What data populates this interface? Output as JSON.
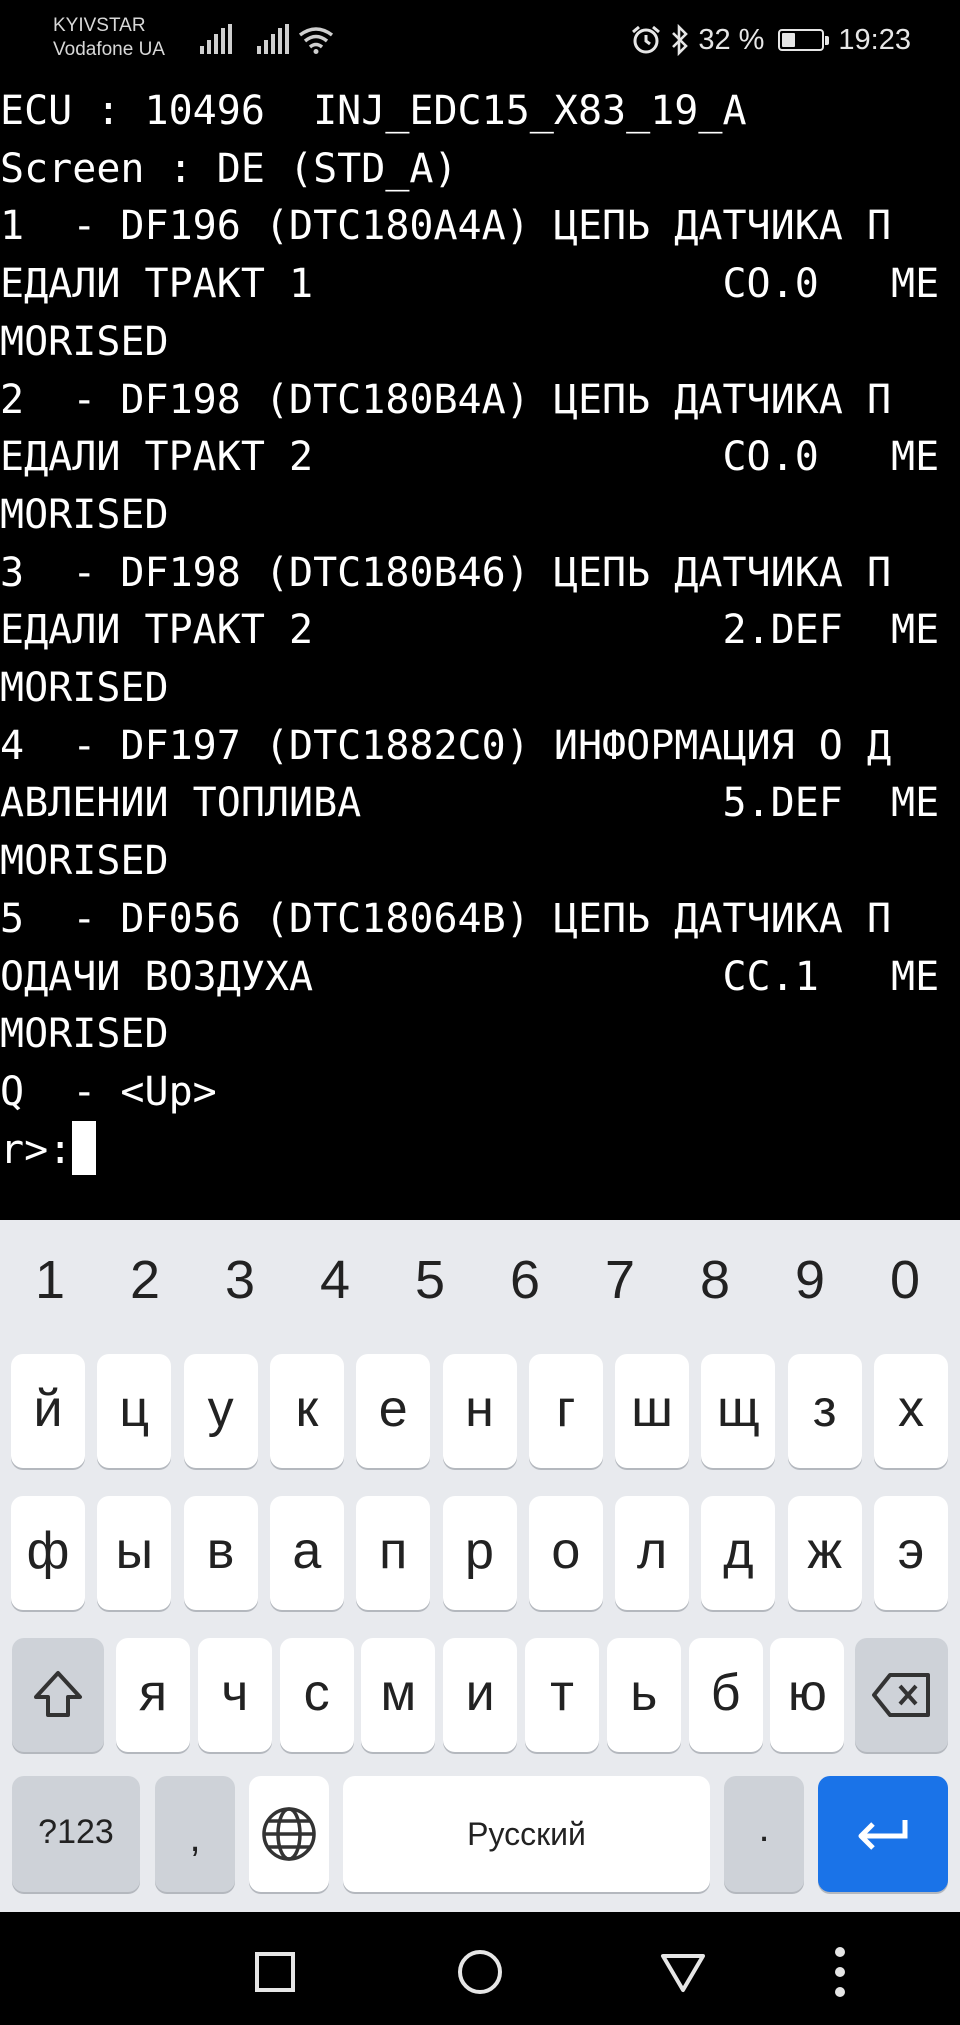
{
  "status_bar": {
    "carrier_1": "KYIVSTAR",
    "carrier_2": "Vodafone UA",
    "battery_percent": "32 %",
    "battery_level": 0.32,
    "time": "19:23",
    "icons": [
      "signal-icon",
      "signal-icon",
      "wifi-icon",
      "alarm-icon",
      "bluetooth-icon",
      "battery-icon"
    ]
  },
  "terminal": {
    "lines": [
      "ECU : 10496  INJ_EDC15_X83_19_A",
      "Screen : DE (STD_A)",
      "1  - DF196 (DTC180A4A) ЦЕПЬ ДАТЧИКА П",
      "ЕДАЛИ ТРАКТ 1                 CO.0   ME",
      "MORISED",
      "2  - DF198 (DTC180B4A) ЦЕПЬ ДАТЧИКА П",
      "ЕДАЛИ ТРАКТ 2                 CO.0   ME",
      "MORISED",
      "3  - DF198 (DTC180B46) ЦЕПЬ ДАТЧИКА П",
      "ЕДАЛИ ТРАКТ 2                 2.DEF  ME",
      "MORISED",
      "4  - DF197 (DTC1882C0) ИНФОРМАЦИЯ О Д",
      "АВЛЕНИИ ТОПЛИВА               5.DEF  ME",
      "MORISED",
      "5  - DF056 (DTC18064B) ЦЕПЬ ДАТЧИКА П",
      "ОДАЧИ ВОЗДУХА                 CC.1   ME",
      "MORISED",
      "Q  - <Up>",
      "r>:"
    ]
  },
  "keyboard": {
    "numbers": [
      "1",
      "2",
      "3",
      "4",
      "5",
      "6",
      "7",
      "8",
      "9",
      "0"
    ],
    "row_a": [
      "й",
      "ц",
      "у",
      "к",
      "е",
      "н",
      "г",
      "ш",
      "щ",
      "з",
      "х"
    ],
    "row_b": [
      "ф",
      "ы",
      "в",
      "а",
      "п",
      "р",
      "о",
      "л",
      "д",
      "ж",
      "э"
    ],
    "row_c": [
      "я",
      "ч",
      "с",
      "м",
      "и",
      "т",
      "ь",
      "б",
      "ю"
    ],
    "symbols_label": "?123",
    "comma_label": ",",
    "space_label": "Русский",
    "period_label": ".",
    "icons": [
      "shift-icon",
      "backspace-icon",
      "globe-icon",
      "enter-icon"
    ],
    "accent_color": "#1a73e8"
  },
  "nav_bar": {
    "icons": [
      "recents-icon",
      "home-icon",
      "back-icon",
      "more-icon"
    ]
  }
}
